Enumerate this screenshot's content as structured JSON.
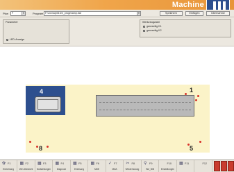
{
  "window": {
    "title": "Machine"
  },
  "toolbar": {
    "plan_label": "Plan",
    "plan_value": "F",
    "program_label": "Program",
    "program_value": "F:\\cnc\\\\ap\\01\\ire_progexamp.bat",
    "buttons": [
      "Speichern",
      "Einfügen",
      "Übernahme"
    ]
  },
  "settings": {
    "left_group": {
      "title": "Parameter",
      "option": "LED-Anzeige"
    },
    "right_group": {
      "title": "Werkzeugwahl",
      "options": [
        "ganzseitig K1",
        "ganzseitig K2"
      ]
    }
  },
  "canvas": {
    "labels": [
      "4",
      "1",
      "8",
      "5"
    ]
  },
  "fkeys": [
    {
      "code": "F1",
      "label": "Einrichtung",
      "icon": "tool-icon",
      "glyph": "✿"
    },
    {
      "code": "F2",
      "label": "WZ-Übersicht",
      "icon": "grid-icon",
      "glyph": "▦"
    },
    {
      "code": "F3",
      "label": "Nullstellungen",
      "icon": "grid-icon",
      "glyph": "▦"
    },
    {
      "code": "F4",
      "label": "Diagnose",
      "icon": "grid-icon",
      "glyph": "▦"
    },
    {
      "code": "F5",
      "label": "Einlesung",
      "icon": "grid-icon",
      "glyph": "▦"
    },
    {
      "code": "F6",
      "label": "MDE",
      "icon": "grid-icon",
      "glyph": "▦"
    },
    {
      "code": "F7",
      "label": "MDA",
      "icon": "check-icon",
      "glyph": "✓"
    },
    {
      "code": "F8",
      "label": "Wiederholung",
      "icon": "scissors-icon",
      "glyph": "✂"
    },
    {
      "code": "F9",
      "label": "WZ_BIB",
      "icon": "search-icon",
      "glyph": "⚲"
    },
    {
      "code": "F10",
      "label": "Einstellungen",
      "icon": "none",
      "glyph": ""
    },
    {
      "code": "F11",
      "label": "",
      "icon": "grid-icon",
      "glyph": "▦"
    },
    {
      "code": "F12",
      "label": "",
      "icon": "none",
      "glyph": ""
    }
  ],
  "colors": {
    "titlebar": "#f0a54a",
    "logo_blue": "#2d4f8e",
    "bed_yellow": "#fbf3c8",
    "marker_red": "#d8322a"
  }
}
